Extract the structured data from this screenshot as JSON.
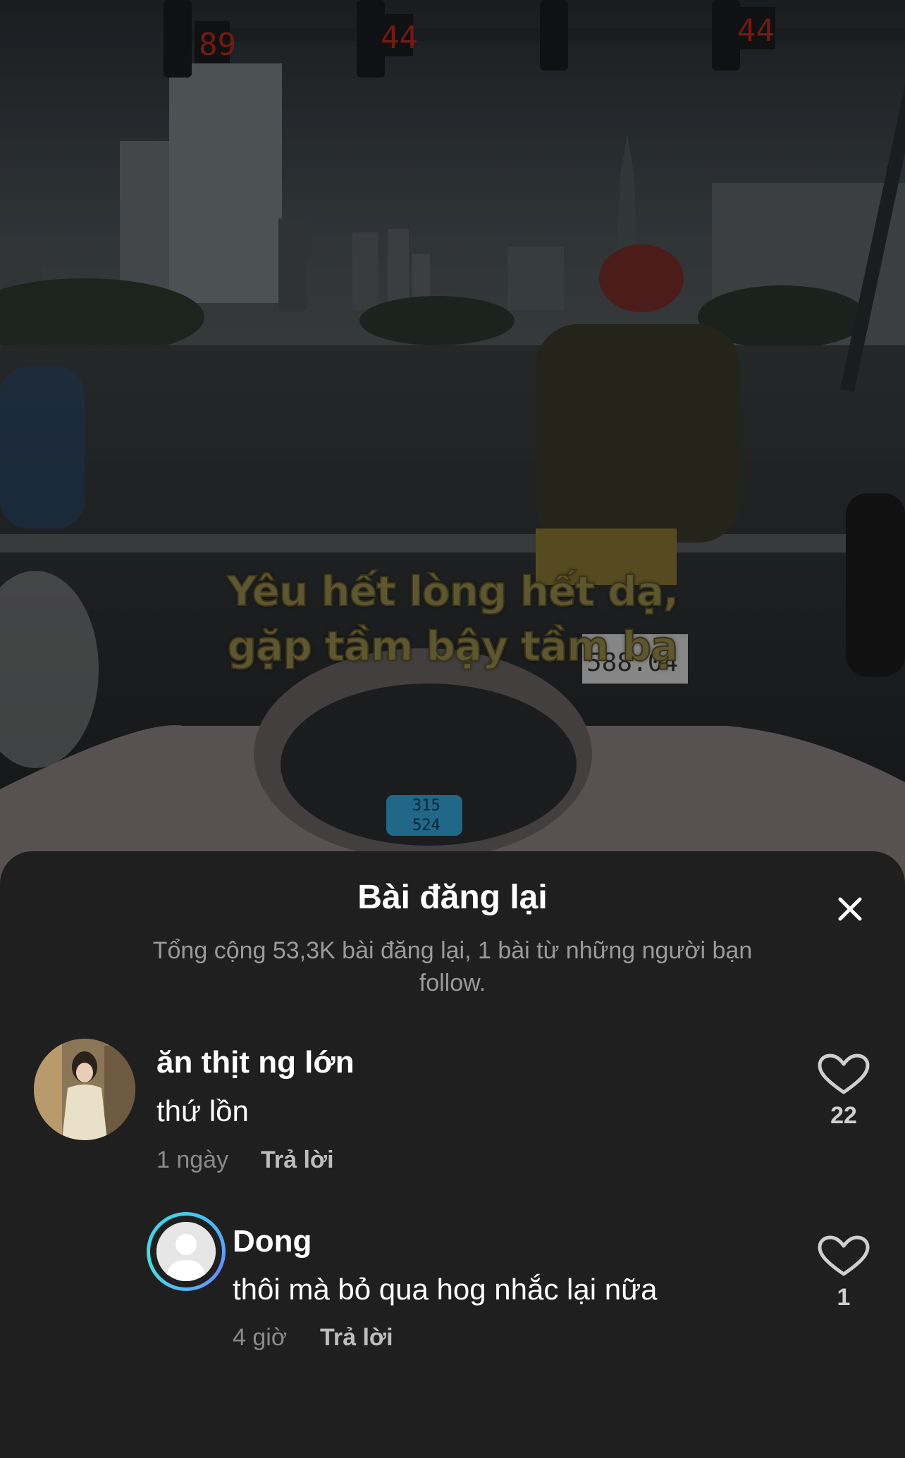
{
  "video": {
    "caption_line1": "Yêu hết lòng hết dạ,",
    "caption_line2": "gặp tầm bậy tầm bạ",
    "signal_timers": [
      "89",
      "44",
      "44"
    ],
    "plate_text": "588.04",
    "odometer_top": "315",
    "odometer_bottom": "524"
  },
  "sheet": {
    "title": "Bài đăng lại",
    "subtitle": "Tổng cộng 53,3K bài đăng lại, 1 bài từ những người bạn follow.",
    "close_icon": "close-icon"
  },
  "comments": [
    {
      "username": "ăn thịt ng lớn",
      "text": "thứ lồn",
      "time": "1 ngày",
      "reply_label": "Trả lời",
      "likes": "22"
    },
    {
      "username": "Dong",
      "text": "thôi mà bỏ qua hog nhắc lại nữa",
      "time": "4 giờ",
      "reply_label": "Trả lời",
      "likes": "1"
    }
  ],
  "colors": {
    "sheet_bg": "#1f1f1f",
    "caption": "#5e5630",
    "ring_accent": "#3fd0ee"
  }
}
